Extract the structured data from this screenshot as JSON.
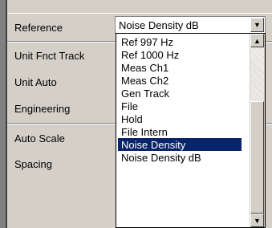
{
  "form": {
    "rows": [
      {
        "label": "Reference"
      },
      {
        "label": "Unit Fnct Track"
      },
      {
        "label": "Unit Auto"
      },
      {
        "label": "Engineering"
      },
      {
        "label": "Auto Scale"
      },
      {
        "label": "Spacing"
      }
    ]
  },
  "reference_combo": {
    "value": "Noise Density dB",
    "arrow_icon": "triangle-down"
  },
  "dropdown": {
    "items": [
      {
        "label": "Ref  997 Hz",
        "selected": false
      },
      {
        "label": "Ref 1000 Hz",
        "selected": false
      },
      {
        "label": "Meas Ch1",
        "selected": false
      },
      {
        "label": "Meas Ch2",
        "selected": false
      },
      {
        "label": "Gen Track",
        "selected": false
      },
      {
        "label": "File",
        "selected": false
      },
      {
        "label": "Hold",
        "selected": false
      },
      {
        "label": "File Intern",
        "selected": false
      },
      {
        "label": "Noise Density",
        "selected": true
      },
      {
        "label": "Noise Density dB",
        "selected": false
      }
    ],
    "highlight_color": "#0a246a"
  }
}
